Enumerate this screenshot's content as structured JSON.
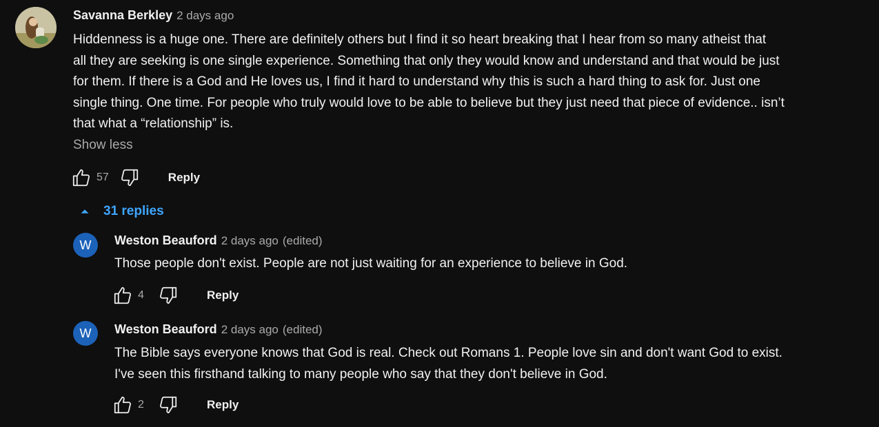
{
  "comment": {
    "author": "Savanna Berkley",
    "time": "2 days ago",
    "lines": [
      "Hiddenness is a huge one. There are definitely others but I find it so heart breaking that I hear from so many atheist that",
      "all they are seeking is one single experience. Something that only they would know and understand and that would be just",
      "for them. If there is a God and He loves us, I find it hard to understand why this is such a hard thing to ask for. Just one",
      "single thing. One time. For people who truly would love to be able to believe but they just need that piece of evidence.. isn’t",
      "that what a “relationship” is."
    ],
    "show_less": "Show less",
    "likes": "57",
    "reply_label": "Reply"
  },
  "replies_toggle": {
    "label": "31 replies"
  },
  "replies": [
    {
      "avatar_letter": "W",
      "author": "Weston Beauford",
      "time": "2 days ago",
      "edited": "(edited)",
      "lines": [
        "Those people don't exist.  People are not just waiting for an experience to believe in God."
      ],
      "likes": "4",
      "reply_label": "Reply"
    },
    {
      "avatar_letter": "W",
      "author": "Weston Beauford",
      "time": "2 days ago",
      "edited": "(edited)",
      "lines": [
        "The Bible says everyone knows that God is real.  Check out Romans 1.   People love sin and don't want God to exist.",
        "I've seen this firsthand talking to many people who say that they don't believe in God."
      ],
      "likes": "2",
      "reply_label": "Reply"
    }
  ],
  "colors": {
    "background": "#0f0f0f",
    "link_blue": "#3ea6ff",
    "avatar_blue": "#1c62b9"
  }
}
